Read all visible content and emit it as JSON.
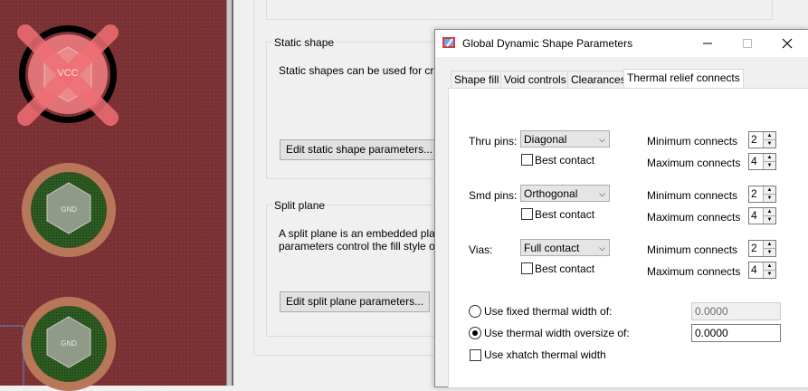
{
  "pcb": {
    "vcc_label": "VCC",
    "gnd_label_1": "GND",
    "gnd_label_2": "GND"
  },
  "background": {
    "static_shape": {
      "title": "Static shape",
      "description": "Static shapes can be used for critica",
      "button": "Edit static shape parameters..."
    },
    "split_plane": {
      "title": "Split plane",
      "description_line1": "A split plane is an embedded plane w",
      "description_line2": "parameters control the fill style of sha",
      "button": "Edit split plane parameters..."
    }
  },
  "dialog": {
    "title": "Global Dynamic Shape Parameters",
    "tabs": [
      {
        "label": "Shape fill"
      },
      {
        "label": "Void controls"
      },
      {
        "label": "Clearances"
      },
      {
        "label": "Thermal relief connects"
      }
    ],
    "rows": [
      {
        "label": "Thru pins:",
        "selected": "Diagonal",
        "best_contact": "Best contact",
        "min_label": "Minimum connects",
        "min_value": "2",
        "max_label": "Maximum connects",
        "max_value": "4"
      },
      {
        "label": "Smd pins:",
        "selected": "Orthogonal",
        "best_contact": "Best contact",
        "min_label": "Minimum connects",
        "min_value": "2",
        "max_label": "Maximum connects",
        "max_value": "4"
      },
      {
        "label": "Vias:",
        "selected": "Full contact",
        "best_contact": "Best contact",
        "min_label": "Minimum connects",
        "min_value": "2",
        "max_label": "Maximum connects",
        "max_value": "4"
      }
    ],
    "fixed_width_label": "Use fixed thermal width of:",
    "fixed_width_value": "0.0000",
    "oversize_label": "Use thermal width oversize of:",
    "oversize_value": "0.0000",
    "xhatch_label": "Use xhatch thermal width"
  }
}
